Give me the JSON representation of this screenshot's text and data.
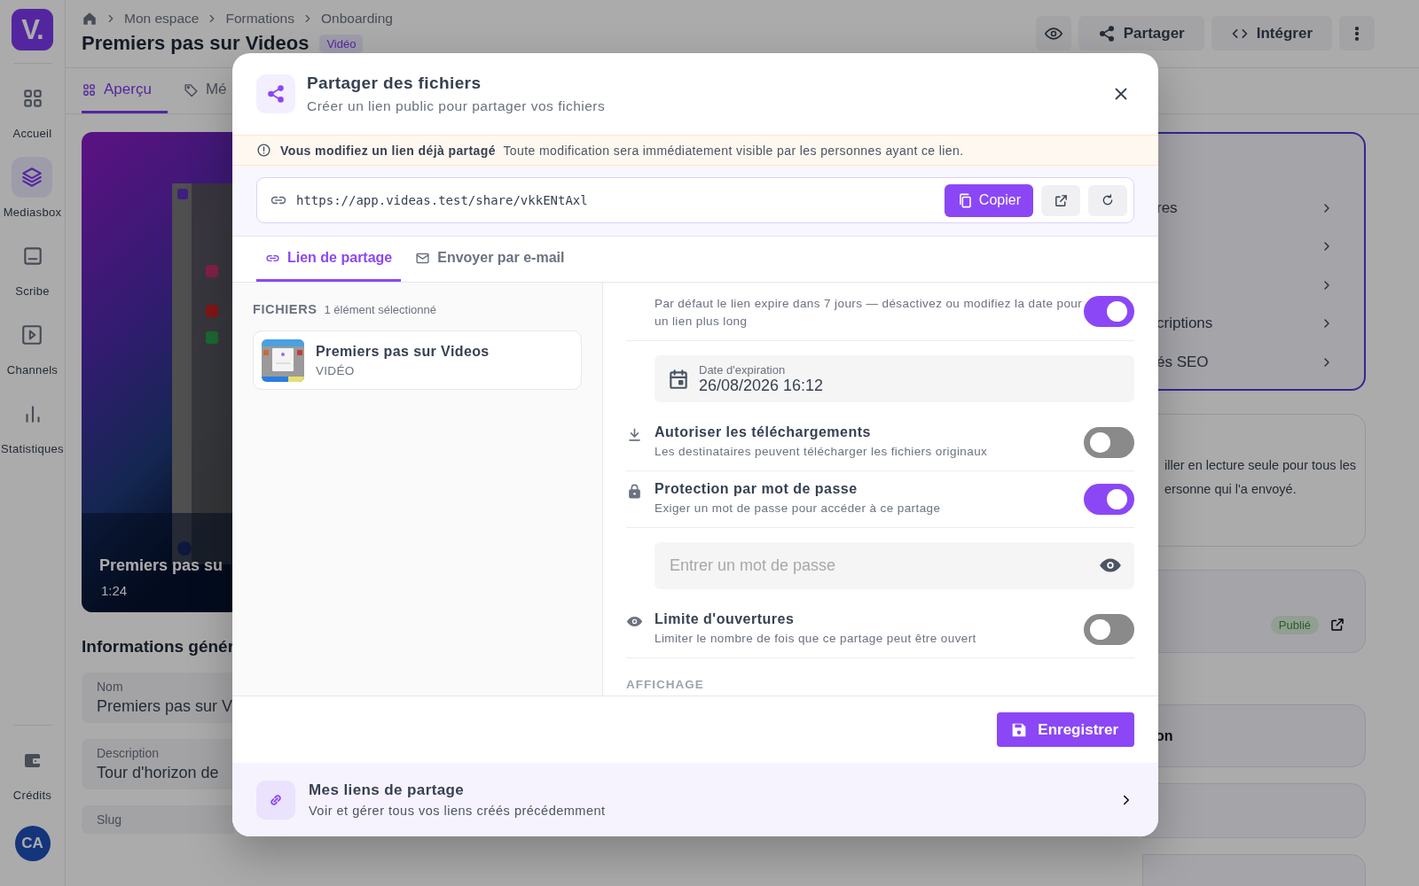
{
  "sidebar": {
    "logo": "V.",
    "items": [
      {
        "label": "Accueil",
        "selected": false
      },
      {
        "label": "Mediasbox",
        "selected": true
      },
      {
        "label": "Scribe",
        "selected": false
      },
      {
        "label": "Channels",
        "selected": false
      },
      {
        "label": "Statistiques",
        "selected": false
      }
    ],
    "footer_item": {
      "label": "Crédits"
    },
    "avatar": "CA"
  },
  "header": {
    "breadcrumb": [
      "Mon espace",
      "Formations",
      "Onboarding"
    ],
    "title": "Premiers pas sur Videos",
    "badge": "Vidéo",
    "actions": [
      "Partager",
      "Intégrer"
    ]
  },
  "tabs": [
    {
      "label": "Aperçu",
      "selected": true
    },
    {
      "label": "Mé",
      "selected": false
    }
  ],
  "preview": {
    "title": "Premiers pas su",
    "duration": "1:24"
  },
  "info": {
    "heading": "Informations génér",
    "fields": [
      {
        "label": "Nom",
        "value": "Premiers pas sur V"
      },
      {
        "label": "Description",
        "value": "Tour d'horizon de"
      },
      {
        "label": "Slug"
      }
    ]
  },
  "side_panel": {
    "menu": [
      {
        "kind": "labeled",
        "label": "res"
      },
      {
        "kind": "blank"
      },
      {
        "kind": "blank"
      },
      {
        "kind": "labeled",
        "label": "criptions"
      },
      {
        "kind": "labeled",
        "label": "és SEO"
      }
    ],
    "note": [
      "iller en lecture seule pour tous les",
      "ersonne qui l'a envoyé."
    ],
    "status": "Publié",
    "section": "on"
  },
  "modal": {
    "title": "Partager des fichiers",
    "subtitle": "Créer un lien public pour partager vos fichiers",
    "warning": {
      "title": "Vous modifiez un lien déjà partagé",
      "text": "Toute modification sera immédiatement visible par les personnes ayant ce lien."
    },
    "link": {
      "url": "https://app.videas.test/share/vkkENtAxl",
      "copy": "Copier"
    },
    "tabs": [
      {
        "label": "Lien de partage",
        "selected": true
      },
      {
        "label": "Envoyer par e-mail",
        "selected": false
      }
    ],
    "files": {
      "heading": "FICHIERS",
      "count": "1 élément sélectionné",
      "items": [
        {
          "name": "Premiers pas sur Videos",
          "type": "VIDÉO"
        }
      ]
    },
    "options": [
      {
        "kind": "toggle",
        "description": "Par défaut le lien expire dans 7 jours — désactivez ou modifiez la date pour un lien plus long",
        "on": true
      },
      {
        "kind": "date",
        "label": "Date d'expiration",
        "value": "26/08/2026 16:12"
      },
      {
        "kind": "toggle",
        "title": "Autoriser les téléchargements",
        "description": "Les destinataires peuvent télécharger les fichiers originaux",
        "on": false
      },
      {
        "kind": "toggle",
        "title": "Protection par mot de passe",
        "description": "Exiger un mot de passe pour accéder à ce partage",
        "on": true
      },
      {
        "kind": "password",
        "placeholder": "Entrer un mot de passe"
      },
      {
        "kind": "toggle",
        "title": "Limite d'ouvertures",
        "description": "Limiter le nombre de fois que ce partage peut être ouvert",
        "on": false
      }
    ],
    "section": "AFFICHAGE",
    "save": "Enregistrer",
    "links_footer": {
      "title": "Mes liens de partage",
      "subtitle": "Voir et gérer tous vos liens créés précédemment"
    }
  }
}
